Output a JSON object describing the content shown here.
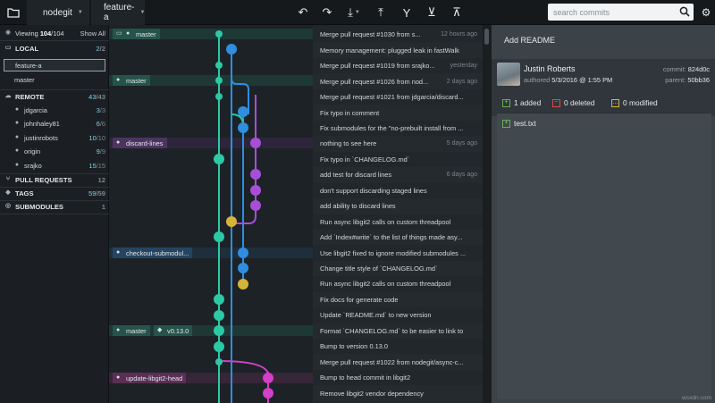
{
  "toolbar": {
    "repo": "nodegit",
    "branch": "feature-a",
    "search_placeholder": "search commits"
  },
  "sidebar": {
    "viewing": "Viewing",
    "viewing_count": "104",
    "viewing_total": "/104",
    "show_all": "Show All",
    "local": {
      "label": "LOCAL",
      "count": "2",
      "total": "/2"
    },
    "local_branches": [
      "feature-a",
      "master"
    ],
    "remote": {
      "label": "REMOTE",
      "count": "43",
      "total": "/43"
    },
    "remotes": [
      {
        "name": "jdgarcia",
        "count": "3",
        "total": "/3"
      },
      {
        "name": "johnhaley81",
        "count": "6",
        "total": "/6"
      },
      {
        "name": "justinrobots",
        "count": "10",
        "total": "/10"
      },
      {
        "name": "origin",
        "count": "9",
        "total": "/9"
      },
      {
        "name": "srajko",
        "count": "15",
        "total": "/15"
      }
    ],
    "pull_requests": {
      "label": "PULL REQUESTS",
      "count": "12"
    },
    "tags": {
      "label": "TAGS",
      "count": "59",
      "total": "/59"
    },
    "submodules": {
      "label": "SUBMODULES",
      "count": "1"
    }
  },
  "graph_labels": [
    {
      "text": "master"
    },
    {
      "text": "master"
    },
    {
      "text": "discard-lines"
    },
    {
      "text": "checkout-submodul..."
    },
    {
      "text": "master"
    },
    {
      "text": "v0.13.0"
    },
    {
      "text": "update-libgit2-head"
    }
  ],
  "commits": [
    {
      "msg": "Merge pull request #1030 from s...",
      "ago": "12 hours ago"
    },
    {
      "msg": "Memory management: plugged leak in fastWalk",
      "ago": ""
    },
    {
      "msg": "Merge pull request #1019 from srajko...",
      "ago": "yesterday"
    },
    {
      "msg": "Merge pull request #1026 from nod...",
      "ago": "2 days ago"
    },
    {
      "msg": "Merge pull request #1021 from jdgarcia/discard...",
      "ago": ""
    },
    {
      "msg": "Fix typo in comment",
      "ago": ""
    },
    {
      "msg": "Fix submodules for the \"no-prebuilt install from ...",
      "ago": ""
    },
    {
      "msg": "nothing to see here",
      "ago": "5 days ago"
    },
    {
      "msg": "Fix typo in `CHANGELOG.md`",
      "ago": ""
    },
    {
      "msg": "add test for discard lines",
      "ago": "6 days ago"
    },
    {
      "msg": "don't support discarding staged lines",
      "ago": ""
    },
    {
      "msg": "add ability to discard lines",
      "ago": ""
    },
    {
      "msg": "Run async libgit2 calls on custom threadpool",
      "ago": ""
    },
    {
      "msg": "Add `Index#write` to the list of things made asy...",
      "ago": ""
    },
    {
      "msg": "Use libgit2 fixed to ignore modified submodules ...",
      "ago": ""
    },
    {
      "msg": "Change title style of `CHANGELOG.md`",
      "ago": ""
    },
    {
      "msg": "Run async libgit2 calls on custom threadpool",
      "ago": ""
    },
    {
      "msg": "Fix docs for generate code",
      "ago": ""
    },
    {
      "msg": "Update `README.md` to new version",
      "ago": ""
    },
    {
      "msg": "Format `CHANGELOG.md` to be easier to link to",
      "ago": ""
    },
    {
      "msg": "Bump to version 0.13.0",
      "ago": ""
    },
    {
      "msg": "Merge pull request #1022 from nodegit/async-c...",
      "ago": ""
    },
    {
      "msg": "Bump to head commit in libgit2",
      "ago": ""
    },
    {
      "msg": "Remove libgit2 vendor dependency",
      "ago": ""
    }
  ],
  "detail": {
    "title": "Add README",
    "author": "Justin Roberts",
    "authored_label": "authored",
    "authored_date": "5/3/2016 @ 1:55 PM",
    "commit_label": "commit:",
    "commit_sha": "824d0c",
    "parent_label": "parent:",
    "parent_sha": "50bb36",
    "added": "1 added",
    "deleted": "0 deleted",
    "modified": "0 modified",
    "file": "test.txt"
  },
  "watermark": "wsxdn.com",
  "colors": {
    "teal": "#2cc9a6",
    "blue": "#2f8ee0",
    "purple": "#a64fd6",
    "magenta": "#d23fc8",
    "green_add": "#63b04f",
    "red_del": "#d94a4a",
    "yellow_mod": "#d7b33a"
  }
}
